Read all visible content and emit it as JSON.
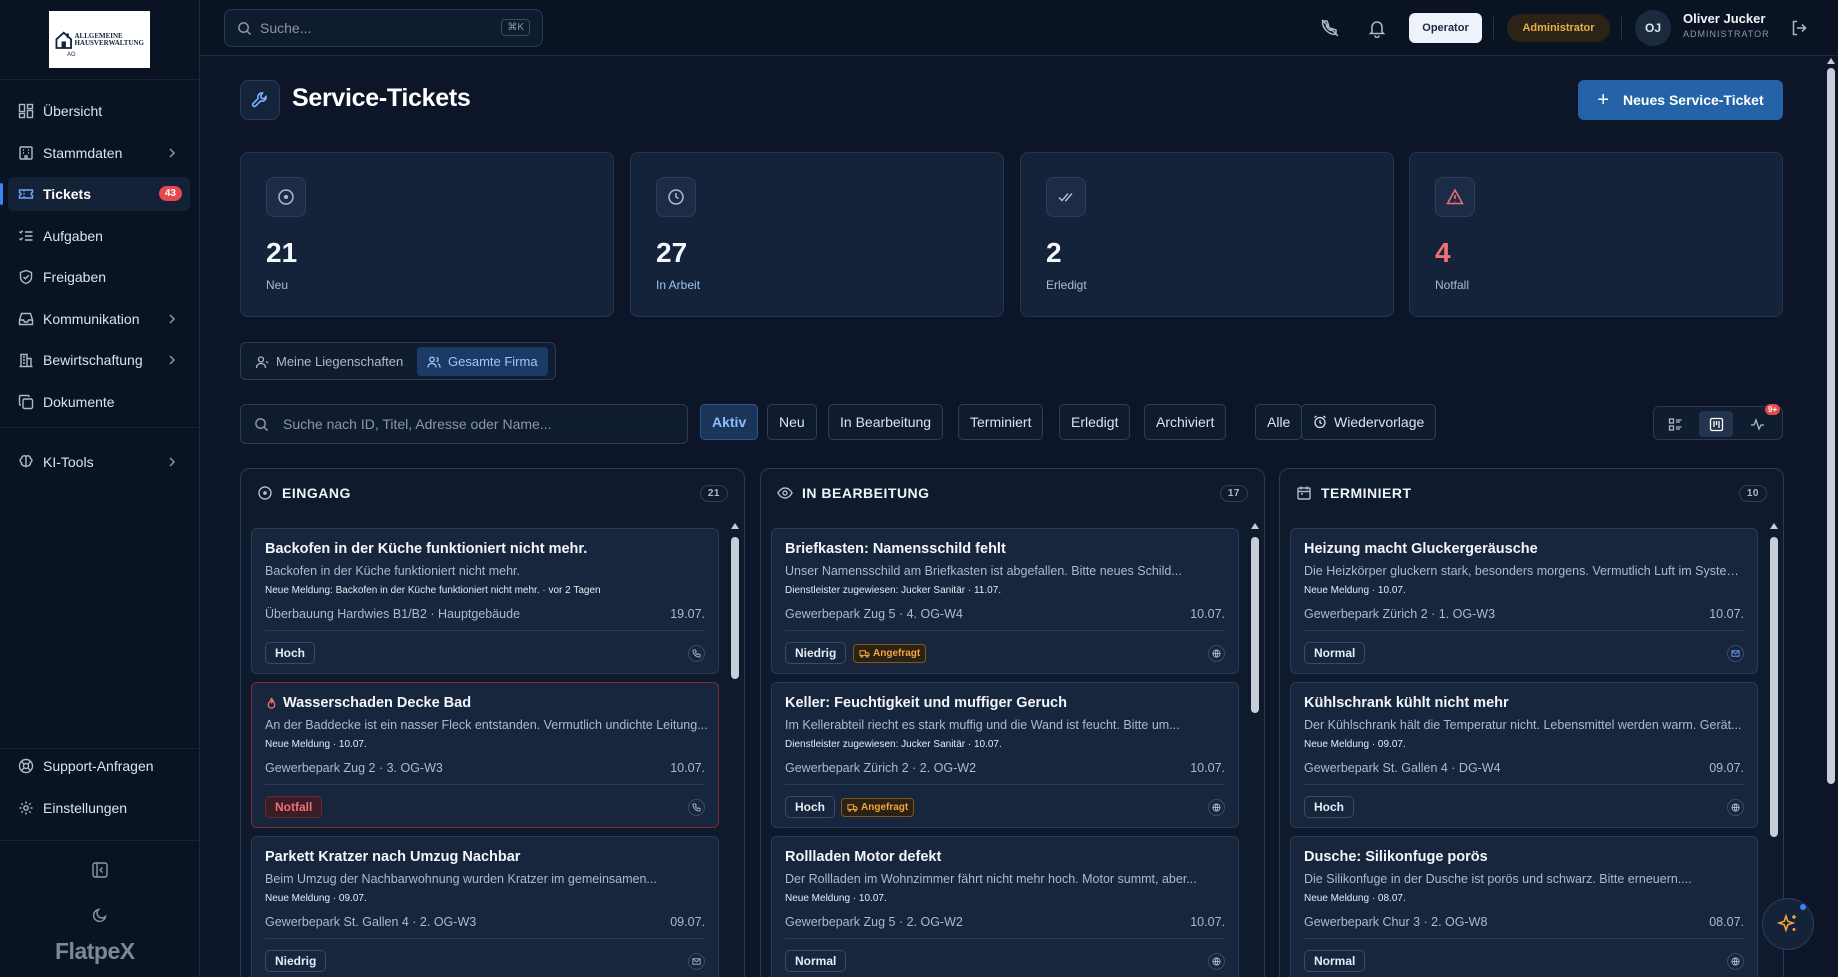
{
  "logo": {
    "line1": "ALLGEMEINE",
    "line2": "HAUSVERWALTUNG",
    "line3": "AG"
  },
  "sidebar": {
    "items": [
      {
        "label": "Übersicht",
        "icon": "dashboard-icon"
      },
      {
        "label": "Stammdaten",
        "icon": "building-icon",
        "expandable": true
      },
      {
        "label": "Tickets",
        "icon": "ticket-icon",
        "badge": "43",
        "active": true
      },
      {
        "label": "Aufgaben",
        "icon": "list-check-icon"
      },
      {
        "label": "Freigaben",
        "icon": "shield-check-icon"
      },
      {
        "label": "Kommunikation",
        "icon": "inbox-icon",
        "expandable": true
      },
      {
        "label": "Bewirtschaftung",
        "icon": "building-2-icon",
        "expandable": true
      },
      {
        "label": "Dokumente",
        "icon": "copy-icon"
      },
      {
        "label": "KI-Tools",
        "icon": "brain-icon",
        "expandable": true
      }
    ],
    "bottom_items": [
      {
        "label": "Support-Anfragen",
        "icon": "life-buoy-icon"
      },
      {
        "label": "Einstellungen",
        "icon": "gear-icon"
      }
    ],
    "brand": "FlatpeX"
  },
  "topbar": {
    "search_placeholder": "Suche...",
    "shortcut": "⌘K",
    "operator_label": "Operator",
    "admin_label": "Administrator",
    "user": {
      "initials": "OJ",
      "name": "Oliver Jucker",
      "role": "ADMINISTRATOR"
    }
  },
  "page": {
    "title": "Service-Tickets",
    "new_button": "Neues Service-Ticket"
  },
  "stats": [
    {
      "value": "21",
      "label": "Neu",
      "icon": "circle-dot-icon"
    },
    {
      "value": "27",
      "label": "In Arbeit",
      "icon": "clock-icon"
    },
    {
      "value": "2",
      "label": "Erledigt",
      "icon": "double-check-icon"
    },
    {
      "value": "4",
      "label": "Notfall",
      "icon": "alert-triangle-icon"
    }
  ],
  "scope": {
    "mine": "Meine Liegenschaften",
    "all": "Gesamte Firma",
    "selected": "Gesamte Firma"
  },
  "filters": {
    "search_placeholder": "Suche nach ID, Titel, Adresse oder Name...",
    "chips": [
      "Aktiv",
      "Neu",
      "In Bearbeitung",
      "Terminiert",
      "Erledigt",
      "Archiviert",
      "Alle"
    ],
    "selected": "Aktiv",
    "followup": "Wiedervorlage",
    "views_badge": "9+"
  },
  "columns": [
    {
      "title": "EINGANG",
      "count": "21",
      "icon": "circle-dot-icon",
      "cards": [
        {
          "title": "Backofen in der Küche funktioniert nicht mehr.",
          "desc": "Backofen in der Küche funktioniert nicht mehr.",
          "meta": "Neue Meldung: Backofen in der Küche funktioniert nicht mehr. · vor 2 Tagen",
          "address": "Überbauung Hardwies B1/B2 · Hauptgebäude",
          "date": "19.07.",
          "priority": "Hoch",
          "channel": "phone-icon"
        },
        {
          "title": "Wasserschaden Decke Bad",
          "desc": "An der Baddecke ist ein nasser Fleck entstanden. Vermutlich undichte Leitung...",
          "meta": "Neue Meldung · 10.07.",
          "address": "Gewerbepark Zug 2 · 3. OG-W3",
          "date": "10.07.",
          "priority": "Notfall",
          "channel": "phone-icon",
          "emergency": true
        },
        {
          "title": "Parkett Kratzer nach Umzug Nachbar",
          "desc": "Beim Umzug der Nachbarwohnung wurden Kratzer im gemeinsamen...",
          "meta": "Neue Meldung · 09.07.",
          "address": "Gewerbepark St. Gallen 4 · 2. OG-W3",
          "date": "09.07.",
          "priority": "Niedrig",
          "channel": "mail-icon"
        }
      ]
    },
    {
      "title": "IN BEARBEITUNG",
      "count": "17",
      "icon": "eye-icon",
      "cards": [
        {
          "title": "Briefkasten: Namensschild fehlt",
          "desc": "Unser Namensschild am Briefkasten ist abgefallen. Bitte neues Schild...",
          "meta": "Dienstleister zugewiesen: Jucker Sanitär · 11.07.",
          "address": "Gewerbepark Zug 5 · 4. OG-W4",
          "date": "10.07.",
          "priority": "Niedrig",
          "tag": "Angefragt",
          "channel": "globe-icon"
        },
        {
          "title": "Keller: Feuchtigkeit und muffiger Geruch",
          "desc": "Im Kellerabteil riecht es stark muffig und die Wand ist feucht. Bitte um...",
          "meta": "Dienstleister zugewiesen: Jucker Sanitär · 10.07.",
          "address": "Gewerbepark Zürich 2 · 2. OG-W2",
          "date": "10.07.",
          "priority": "Hoch",
          "tag": "Angefragt",
          "channel": "globe-icon"
        },
        {
          "title": "Rollladen Motor defekt",
          "desc": "Der Rollladen im Wohnzimmer fährt nicht mehr hoch. Motor summt, aber...",
          "meta": "Neue Meldung · 10.07.",
          "address": "Gewerbepark Zug 5 · 2. OG-W2",
          "date": "10.07.",
          "priority": "Normal",
          "channel": "globe-icon"
        }
      ]
    },
    {
      "title": "TERMINIERT",
      "count": "10",
      "icon": "calendar-icon",
      "cards": [
        {
          "title": "Heizung macht Gluckergeräusche",
          "desc": "Die Heizkörper gluckern stark, besonders morgens. Vermutlich Luft im System ...",
          "meta": "Neue Meldung · 10.07.",
          "address": "Gewerbepark Zürich 2 · 1. OG-W3",
          "date": "10.07.",
          "priority": "Normal",
          "channel": "mail-icon"
        },
        {
          "title": "Kühlschrank kühlt nicht mehr",
          "desc": "Der Kühlschrank hält die Temperatur nicht. Lebensmittel werden warm. Gerät...",
          "meta": "Neue Meldung · 09.07.",
          "address": "Gewerbepark St. Gallen 4 · DG-W4",
          "date": "09.07.",
          "priority": "Hoch",
          "channel": "globe-icon"
        },
        {
          "title": "Dusche: Silikonfuge porös",
          "desc": "Die Silikonfuge in der Dusche ist porös und schwarz. Bitte erneuern....",
          "meta": "Neue Meldung · 08.07.",
          "address": "Gewerbepark Chur 3 · 2. OG-W8",
          "date": "08.07.",
          "priority": "Normal",
          "channel": "globe-icon"
        }
      ]
    }
  ]
}
